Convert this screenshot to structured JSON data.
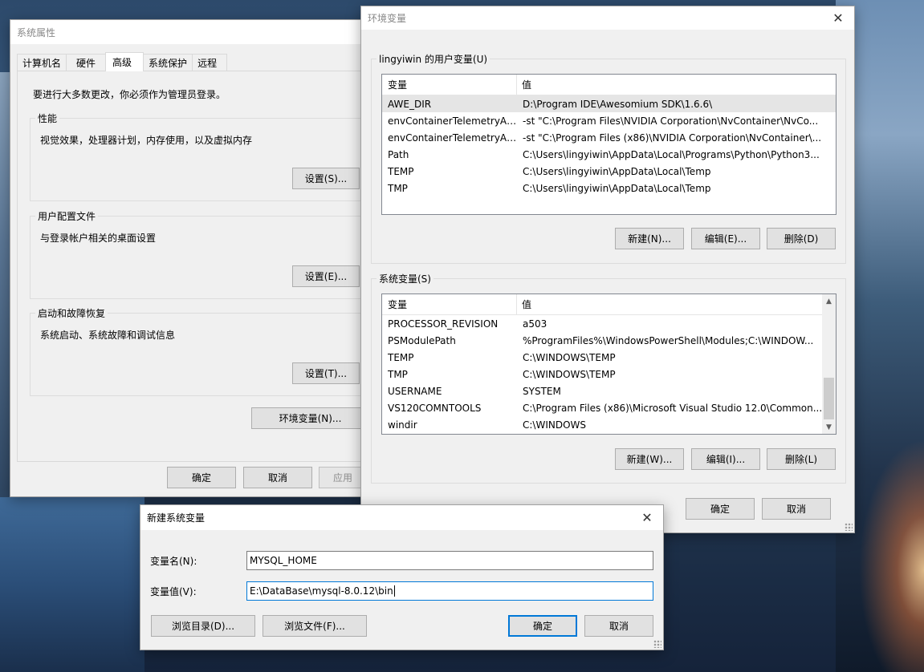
{
  "sysprops": {
    "title": "系统属性",
    "tabs": [
      "计算机名",
      "硬件",
      "高级",
      "系统保护",
      "远程"
    ],
    "admin_note": "要进行大多数更改，你必须作为管理员登录。",
    "performance": {
      "label": "性能",
      "desc": "视觉效果，处理器计划，内存使用，以及虚拟内存",
      "button": "设置(S)..."
    },
    "profiles": {
      "label": "用户配置文件",
      "desc": "与登录帐户相关的桌面设置",
      "button": "设置(E)..."
    },
    "startup": {
      "label": "启动和故障恢复",
      "desc": "系统启动、系统故障和调试信息",
      "button": "设置(T)..."
    },
    "env_button": "环境变量(N)...",
    "ok": "确定",
    "cancel": "取消",
    "apply": "应用"
  },
  "envvars": {
    "title": "环境变量",
    "user_group": "lingyiwin 的用户变量(U)",
    "col_var": "变量",
    "col_val": "值",
    "user_vars": [
      {
        "name": "AWE_DIR",
        "value": "D:\\Program IDE\\Awesomium SDK\\1.6.6\\"
      },
      {
        "name": "envContainerTelemetryAp...",
        "value": "-st \"C:\\Program Files\\NVIDIA Corporation\\NvContainer\\NvCo..."
      },
      {
        "name": "envContainerTelemetryAp...",
        "value": "-st \"C:\\Program Files (x86)\\NVIDIA Corporation\\NvContainer\\..."
      },
      {
        "name": "Path",
        "value": "C:\\Users\\lingyiwin\\AppData\\Local\\Programs\\Python\\Python3..."
      },
      {
        "name": "TEMP",
        "value": "C:\\Users\\lingyiwin\\AppData\\Local\\Temp"
      },
      {
        "name": "TMP",
        "value": "C:\\Users\\lingyiwin\\AppData\\Local\\Temp"
      }
    ],
    "user_new": "新建(N)...",
    "user_edit": "编辑(E)...",
    "user_delete": "删除(D)",
    "sys_group": "系统变量(S)",
    "sys_vars": [
      {
        "name": "PROCESSOR_REVISION",
        "value": "a503"
      },
      {
        "name": "PSModulePath",
        "value": "%ProgramFiles%\\WindowsPowerShell\\Modules;C:\\WINDOW..."
      },
      {
        "name": "TEMP",
        "value": "C:\\WINDOWS\\TEMP"
      },
      {
        "name": "TMP",
        "value": "C:\\WINDOWS\\TEMP"
      },
      {
        "name": "USERNAME",
        "value": "SYSTEM"
      },
      {
        "name": "VS120COMNTOOLS",
        "value": "C:\\Program Files (x86)\\Microsoft Visual Studio 12.0\\Common..."
      },
      {
        "name": "windir",
        "value": "C:\\WINDOWS"
      }
    ],
    "sys_new": "新建(W)...",
    "sys_edit": "编辑(I)...",
    "sys_delete": "删除(L)",
    "ok": "确定",
    "cancel": "取消"
  },
  "newvar": {
    "title": "新建系统变量",
    "name_label": "变量名(N):",
    "name_value": "MYSQL_HOME",
    "value_label": "变量值(V):",
    "value_value": "E:\\DataBase\\mysql-8.0.12\\bin",
    "browse_dir": "浏览目录(D)...",
    "browse_file": "浏览文件(F)...",
    "ok": "确定",
    "cancel": "取消"
  },
  "icons": {
    "close": "close-icon",
    "scroll_up": "chevron-up-icon",
    "scroll_down": "chevron-down-icon"
  }
}
